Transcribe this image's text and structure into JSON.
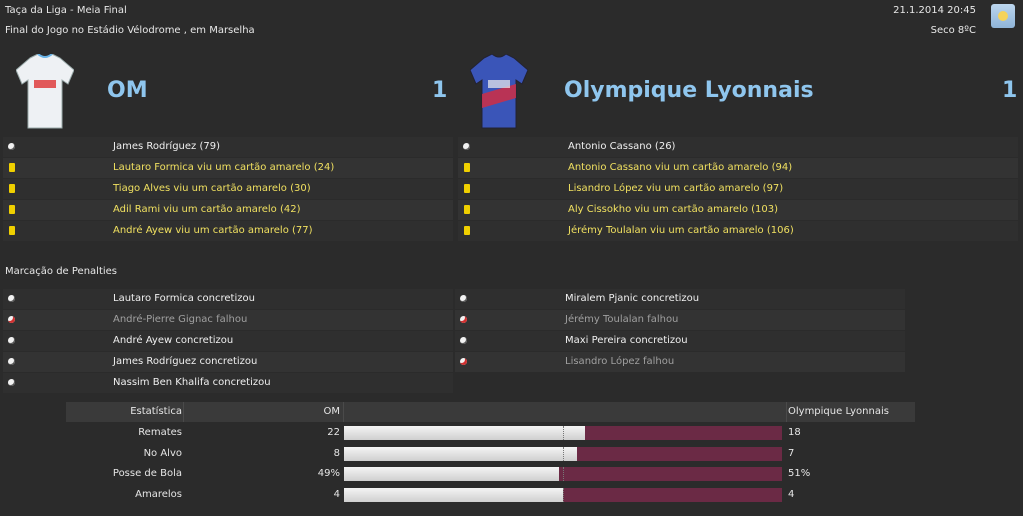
{
  "header": {
    "competition": "Taça da Liga - Meia Final",
    "venue": "Final do Jogo no Estádio Vélodrome , em Marselha",
    "datetime": "21.1.2014 20:45",
    "weather": "Seco 8ºC",
    "weather_icon": "sun-icon"
  },
  "home": {
    "name": "OM",
    "score": "1",
    "events": [
      {
        "type": "goal",
        "text": "James Rodríguez (79)"
      },
      {
        "type": "yellow",
        "text": "Lautaro Formica viu um cartão amarelo (24)"
      },
      {
        "type": "yellow",
        "text": "Tiago Alves viu um cartão amarelo (30)"
      },
      {
        "type": "yellow",
        "text": "Adil Rami viu um cartão amarelo (42)"
      },
      {
        "type": "yellow",
        "text": "André Ayew viu um cartão amarelo (77)"
      }
    ],
    "penalties": [
      {
        "result": "scored",
        "text": "Lautaro Formica concretizou"
      },
      {
        "result": "missed",
        "text": "André-Pierre Gignac falhou"
      },
      {
        "result": "scored",
        "text": "André Ayew concretizou"
      },
      {
        "result": "scored",
        "text": "James Rodríguez concretizou"
      },
      {
        "result": "scored",
        "text": "Nassim Ben Khalifa concretizou"
      }
    ]
  },
  "away": {
    "name": "Olympique Lyonnais",
    "score": "1",
    "events": [
      {
        "type": "goal",
        "text": "Antonio Cassano (26)"
      },
      {
        "type": "yellow",
        "text": "Antonio Cassano viu um cartão amarelo (94)"
      },
      {
        "type": "yellow",
        "text": "Lisandro López viu um cartão amarelo (97)"
      },
      {
        "type": "yellow",
        "text": "Aly Cissokho viu um cartão amarelo (103)"
      },
      {
        "type": "yellow",
        "text": "Jérémy Toulalan viu um cartão amarelo (106)"
      }
    ],
    "penalties": [
      {
        "result": "scored",
        "text": "Miralem Pjanic concretizou"
      },
      {
        "result": "missed",
        "text": "Jérémy Toulalan falhou"
      },
      {
        "result": "scored",
        "text": "Maxi Pereira concretizou"
      },
      {
        "result": "missed",
        "text": "Lisandro López falhou"
      }
    ]
  },
  "penalties_title": "Marcação de Penalties",
  "stats": {
    "header": {
      "label": "Estatística",
      "home": "OM",
      "away": "Olympique Lyonnais"
    },
    "rows": [
      {
        "label": "Remates",
        "home": "22",
        "away": "18",
        "home_share": 0.55
      },
      {
        "label": "No Alvo",
        "home": "8",
        "away": "7",
        "home_share": 0.533
      },
      {
        "label": "Posse de Bola",
        "home": "49%",
        "away": "51%",
        "home_share": 0.49
      },
      {
        "label": "Amarelos",
        "home": "4",
        "away": "4",
        "home_share": 0.5
      }
    ]
  },
  "colors": {
    "team_name": "#8fc6ee",
    "yellow_text": "#f0e060",
    "bar_away": "#6b2a45",
    "bar_home": "#f4f4f4"
  }
}
